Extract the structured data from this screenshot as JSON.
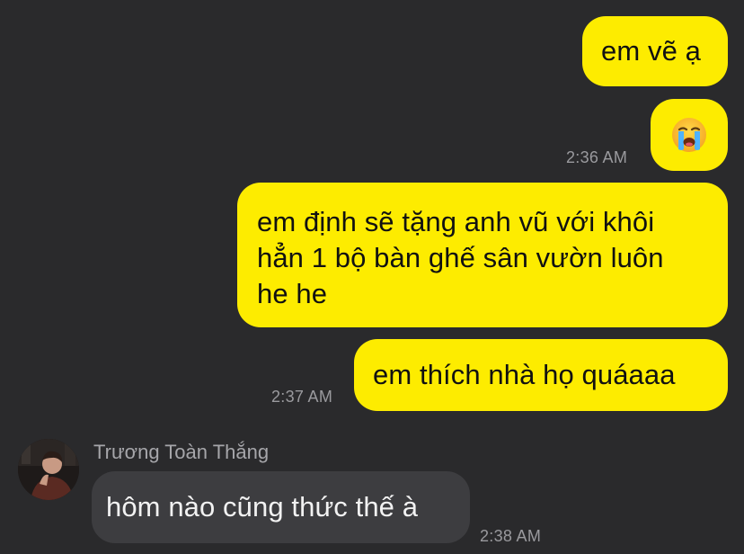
{
  "messages": {
    "m1": {
      "text": "em vẽ ạ"
    },
    "m2": {
      "emoji_name": "loudly-crying-face-icon",
      "time": "2:36 AM"
    },
    "m3": {
      "line1": "em định sẽ tặng anh vũ với khôi",
      "line2": "hẳn 1 bộ bàn ghế sân vườn luôn",
      "line3": "he he"
    },
    "m4": {
      "text": "em thích nhà họ quáaaa",
      "time": "2:37 AM"
    },
    "m5": {
      "sender": "Trương Toàn Thắng",
      "text": "hôm nào cũng thức thế à",
      "time": "2:38 AM"
    }
  },
  "colors": {
    "background": "#2a2a2c",
    "outgoing_bubble": "#fdec00",
    "incoming_bubble": "#3d3d40",
    "timestamp": "#9a9a9e"
  }
}
